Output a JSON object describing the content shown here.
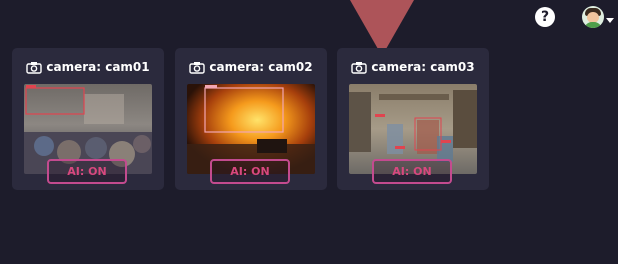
{
  "header": {
    "help_label": "?",
    "help_icon": "help-icon",
    "user_icon": "avatar-icon"
  },
  "cameras": [
    {
      "title": "camera: cam01",
      "ai_label": "AI: ON"
    },
    {
      "title": "camera: cam02",
      "ai_label": "AI: ON"
    },
    {
      "title": "camera: cam03",
      "ai_label": "AI: ON"
    }
  ],
  "colors": {
    "background": "#1d1c2b",
    "card": "#2b2a3d",
    "badge_border": "#c34b8f",
    "badge_text": "#d8487f",
    "pointer": "#b5575c"
  }
}
